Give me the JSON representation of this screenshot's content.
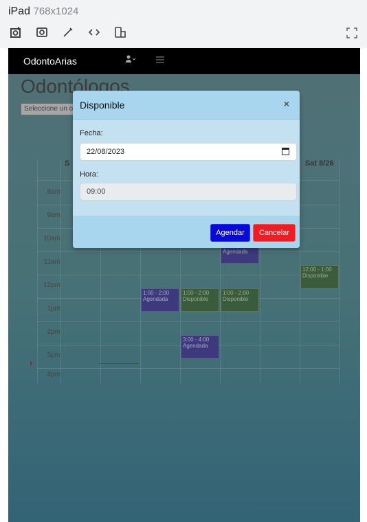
{
  "device": {
    "name": "iPad",
    "dims": "768x1024"
  },
  "navbar": {
    "brand": "OdontoArias",
    "user_icon": "user-icon",
    "menu_icon": "menu-icon"
  },
  "page": {
    "title": "Odontólogos",
    "select_value": "Seleccione un odontólogo"
  },
  "calendar": {
    "last_day_header": "Sat 8/26",
    "first_day_header": "S",
    "times": [
      "8am",
      "9am",
      "10am",
      "11am",
      "12pm",
      "1pm",
      "2pm",
      "3pm",
      "4pm"
    ],
    "events": [
      {
        "time": "",
        "title": "Agendada",
        "color": "blue"
      },
      {
        "time": "12:00 - 1:00",
        "title": "Disponible",
        "color": "green"
      },
      {
        "time": "1:00 - 2:00",
        "title": "Agendada",
        "color": "blue"
      },
      {
        "time": "1:00 - 2:00",
        "title": "Disponible",
        "color": "green"
      },
      {
        "time": "1:00 - 2:00",
        "title": "Disponible",
        "color": "green"
      },
      {
        "time": "3:00 - 4:00",
        "title": "Agendada",
        "color": "blue"
      }
    ]
  },
  "modal": {
    "title": "Disponible",
    "close_label": "×",
    "fecha_label": "Fecha:",
    "fecha_value": "22/08/2023",
    "hora_label": "Hora:",
    "hora_value": "09:00",
    "agendar_label": "Agendar",
    "cancelar_label": "Cancelar"
  }
}
